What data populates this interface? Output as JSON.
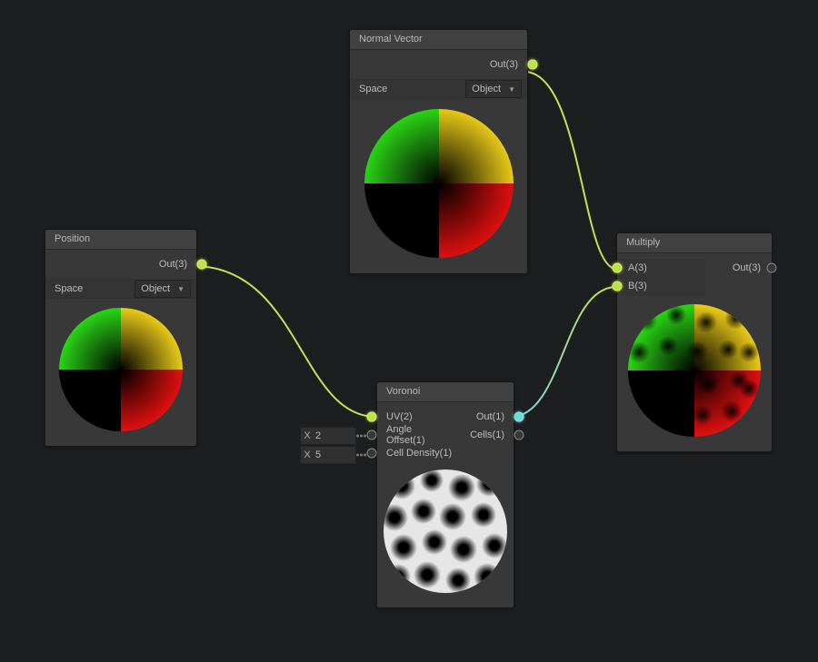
{
  "nodes": {
    "position": {
      "title": "Position",
      "out_label": "Out(3)",
      "space_label": "Space",
      "space_value": "Object"
    },
    "normal": {
      "title": "Normal Vector",
      "out_label": "Out(3)",
      "space_label": "Space",
      "space_value": "Object"
    },
    "voronoi": {
      "title": "Voronoi",
      "inputs": {
        "uv": "UV(2)",
        "angle": "Angle Offset(1)",
        "density": "Cell Density(1)"
      },
      "outputs": {
        "out": "Out(1)",
        "cells": "Cells(1)"
      },
      "params": {
        "angle_value": "2",
        "density_value": "5",
        "x_label": "X"
      }
    },
    "multiply": {
      "title": "Multiply",
      "a_label": "A(3)",
      "b_label": "B(3)",
      "out_label": "Out(3)"
    }
  },
  "wires": [
    {
      "from": "normal.out",
      "to": "multiply.a"
    },
    {
      "from": "position.out",
      "to": "voronoi.uv"
    },
    {
      "from": "voronoi.out",
      "to": "multiply.b"
    }
  ],
  "colors": {
    "lime": "#c3e256",
    "cyan": "#79d7d7",
    "node_bg": "#383838"
  }
}
